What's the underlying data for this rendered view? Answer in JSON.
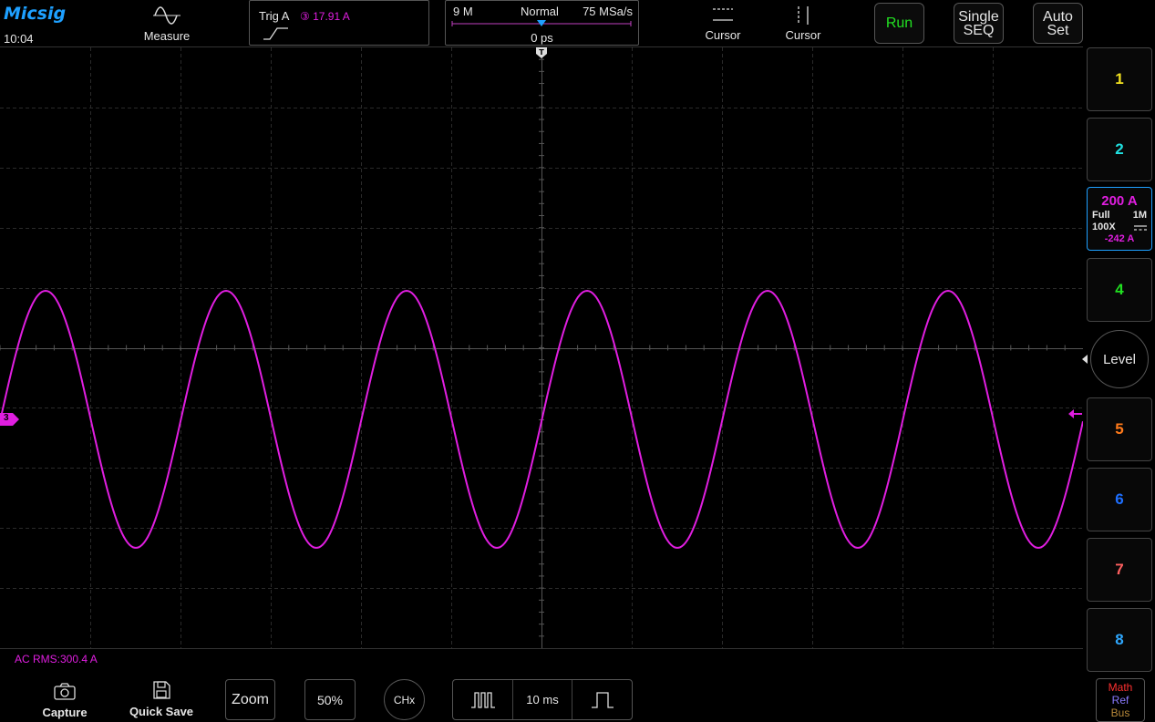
{
  "brand": "Micsig",
  "clock": "10:04",
  "toolbar": {
    "measure_label": "Measure",
    "cursor_h_label": "Cursor",
    "cursor_v_label": "Cursor",
    "run_label": "Run",
    "single_label_1": "Single",
    "single_label_2": "SEQ",
    "auto_label_1": "Auto",
    "auto_label_2": "Set"
  },
  "trigger": {
    "label": "Trig A",
    "channel_symbol": "③",
    "level": "17.91 A"
  },
  "timebase": {
    "memory_depth": "9 M",
    "mode": "Normal",
    "sample_rate": "75 MSa/s",
    "delay": "0 ps"
  },
  "channels": [
    {
      "id": "1",
      "color": "#f0e020"
    },
    {
      "id": "2",
      "color": "#20e0e0"
    },
    {
      "id": "4",
      "color": "#20e020"
    },
    {
      "id": "5",
      "color": "#ff7a1a"
    },
    {
      "id": "6",
      "color": "#1e6fff"
    },
    {
      "id": "7",
      "color": "#ff6060"
    },
    {
      "id": "8",
      "color": "#2fa8ff"
    }
  ],
  "channel3": {
    "scale": "200 A",
    "bandwidth": "Full",
    "impedance": "1M",
    "probe": "100X",
    "coupling_icon": "dc-coupling-icon",
    "offset": "-242 A",
    "color": "#e01ee0",
    "marker": "3"
  },
  "level_label": "Level",
  "measurement": "AC RMS:300.4 A",
  "bottom": {
    "capture_label": "Capture",
    "quick_save_label": "Quick Save",
    "zoom_label": "Zoom",
    "fifty_label": "50%",
    "chx_label": "CHx",
    "time_div": "10 ms"
  },
  "math_ref_bus": {
    "math": "Math",
    "ref": "Ref",
    "bus": "Bus"
  },
  "waveform": {
    "cycles_visible": 6
  }
}
